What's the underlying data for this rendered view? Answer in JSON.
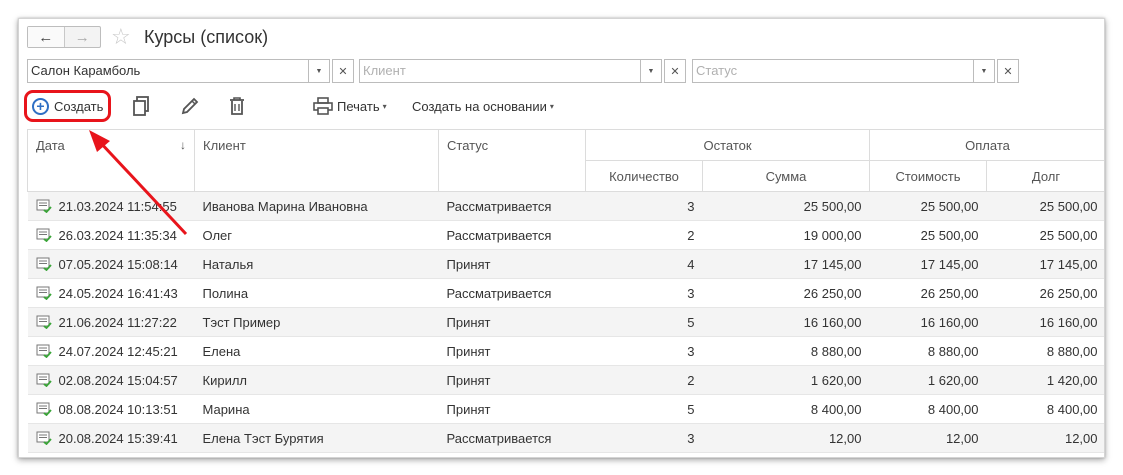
{
  "header": {
    "back_icon": "←",
    "forward_icon": "→",
    "star_icon": "☆",
    "title": "Курсы (список)"
  },
  "filters": {
    "organization": {
      "value": "Салон Карамболь"
    },
    "client": {
      "placeholder": "Клиент"
    },
    "status": {
      "placeholder": "Статус"
    }
  },
  "toolbar": {
    "create_label": "Создать",
    "print_label": "Печать",
    "create_based_label": "Создать на основании",
    "caret": "▾"
  },
  "table": {
    "headers": {
      "date": "Дата",
      "sort_arrow": "↓",
      "client": "Клиент",
      "status": "Статус",
      "remainder": "Остаток",
      "payment": "Оплата",
      "quantity": "Количество",
      "sum": "Сумма",
      "cost": "Стоимость",
      "debt": "Долг"
    },
    "rows": [
      {
        "date": "21.03.2024 11:54:55",
        "client": "Иванова Марина Ивановна",
        "status": "Рассматривается",
        "quantity": "3",
        "sum": "25 500,00",
        "cost": "25 500,00",
        "debt": "25 500,00"
      },
      {
        "date": "26.03.2024 11:35:34",
        "client": "Олег",
        "status": "Рассматривается",
        "quantity": "2",
        "sum": "19 000,00",
        "cost": "25 500,00",
        "debt": "25 500,00"
      },
      {
        "date": "07.05.2024 15:08:14",
        "client": "Наталья",
        "status": "Принят",
        "quantity": "4",
        "sum": "17 145,00",
        "cost": "17 145,00",
        "debt": "17 145,00"
      },
      {
        "date": "24.05.2024 16:41:43",
        "client": "Полина",
        "status": "Рассматривается",
        "quantity": "3",
        "sum": "26 250,00",
        "cost": "26 250,00",
        "debt": "26 250,00"
      },
      {
        "date": "21.06.2024 11:27:22",
        "client": "Тэст Пример",
        "status": "Принят",
        "quantity": "5",
        "sum": "16 160,00",
        "cost": "16 160,00",
        "debt": "16 160,00"
      },
      {
        "date": "24.07.2024 12:45:21",
        "client": "Елена",
        "status": "Принят",
        "quantity": "3",
        "sum": "8 880,00",
        "cost": "8 880,00",
        "debt": "8 880,00"
      },
      {
        "date": "02.08.2024 15:04:57",
        "client": "Кирилл",
        "status": "Принят",
        "quantity": "2",
        "sum": "1 620,00",
        "cost": "1 620,00",
        "debt": "1 420,00"
      },
      {
        "date": "08.08.2024 10:13:51",
        "client": "Марина",
        "status": "Принят",
        "quantity": "5",
        "sum": "8 400,00",
        "cost": "8 400,00",
        "debt": "8 400,00"
      },
      {
        "date": "20.08.2024 15:39:41",
        "client": "Елена Тэст Бурятия",
        "status": "Рассматривается",
        "quantity": "3",
        "sum": "12,00",
        "cost": "12,00",
        "debt": "12,00"
      }
    ]
  },
  "colors": {
    "highlight": "#e8141b",
    "accent": "#2f6fc4",
    "doc_icon_green": "#3aa538"
  }
}
